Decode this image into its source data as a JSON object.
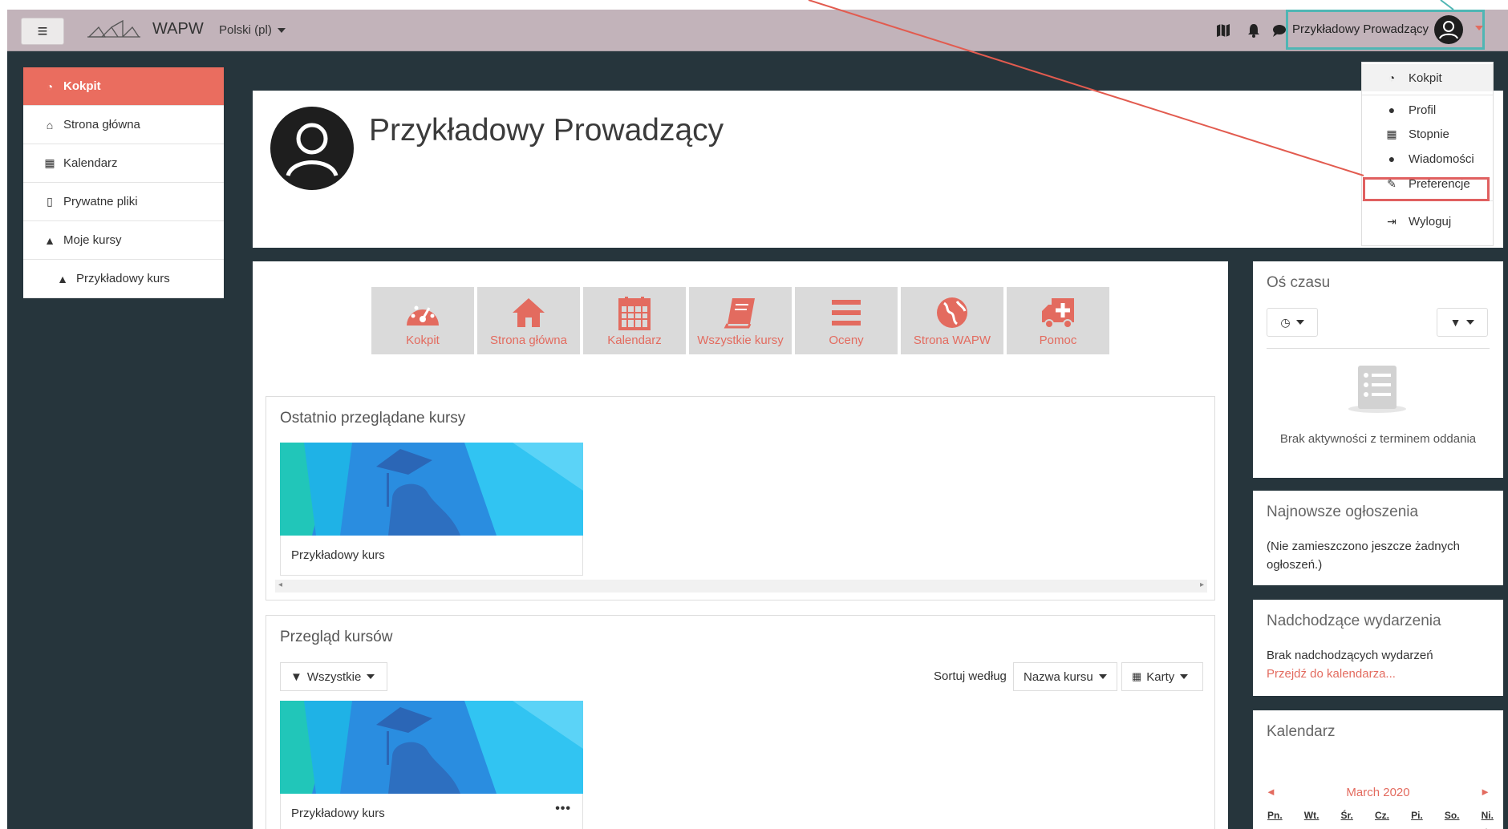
{
  "topbar": {
    "brand": "WAPW",
    "language": "Polski (pl)",
    "user_name": "Przykładowy Prowadzący",
    "icons": [
      "map-icon",
      "bell-icon",
      "chat-icon"
    ]
  },
  "sidebar": {
    "items": [
      {
        "label": "Kokpit",
        "icon": "dashboard-icon"
      },
      {
        "label": "Strona główna",
        "icon": "home-icon"
      },
      {
        "label": "Kalendarz",
        "icon": "calendar-icon"
      },
      {
        "label": "Prywatne pliki",
        "icon": "file-icon"
      },
      {
        "label": "Moje kursy",
        "icon": "graduation-cap-icon"
      },
      {
        "label": "Przykładowy kurs",
        "icon": "graduation-cap-icon"
      }
    ]
  },
  "profile": {
    "name": "Przykładowy Prowadzący"
  },
  "tiles": [
    {
      "label": "Kokpit",
      "icon": "dashboard-icon"
    },
    {
      "label": "Strona główna",
      "icon": "home-icon"
    },
    {
      "label": "Kalendarz",
      "icon": "calendar-icon"
    },
    {
      "label": "Wszystkie kursy",
      "icon": "book-icon"
    },
    {
      "label": "Oceny",
      "icon": "list-icon"
    },
    {
      "label": "Strona WAPW",
      "icon": "globe-icon"
    },
    {
      "label": "Pomoc",
      "icon": "ambulance-icon"
    }
  ],
  "recent": {
    "title": "Ostatnio przeglądane kursy",
    "course": "Przykładowy kurs"
  },
  "overview": {
    "title": "Przegląd kursów",
    "filter": "Wszystkie",
    "sort_label": "Sortuj według",
    "sort_value": "Nazwa kursu",
    "view_value": "Karty",
    "course": "Przykładowy kurs",
    "menu": "•••"
  },
  "timeline": {
    "title": "Oś czasu",
    "empty": "Brak aktywności z terminem oddania"
  },
  "announcements": {
    "title": "Najnowsze ogłoszenia",
    "text": "(Nie zamieszczono jeszcze żadnych ogłoszeń.)"
  },
  "upcoming": {
    "title": "Nadchodzące wydarzenia",
    "text": "Brak nadchodzących wydarzeń",
    "link": "Przejdź do kalendarza..."
  },
  "calendar": {
    "title": "Kalendarz",
    "month": "March 2020",
    "prev": "◄",
    "next": "►",
    "days": [
      "Pn.",
      "Wt.",
      "Śr.",
      "Cz.",
      "Pi.",
      "So.",
      "Ni."
    ],
    "first_day": "1"
  },
  "user_menu": {
    "items": [
      "Kokpit",
      "Profil",
      "Stopnie",
      "Wiadomości",
      "Preferencje",
      "Wyloguj"
    ]
  },
  "colors": {
    "accent": "#e36b5f",
    "topbar": "#c2b3ba",
    "background": "#26353c",
    "highlight_teal": "#4fb6b4",
    "highlight_red": "#e06060"
  }
}
